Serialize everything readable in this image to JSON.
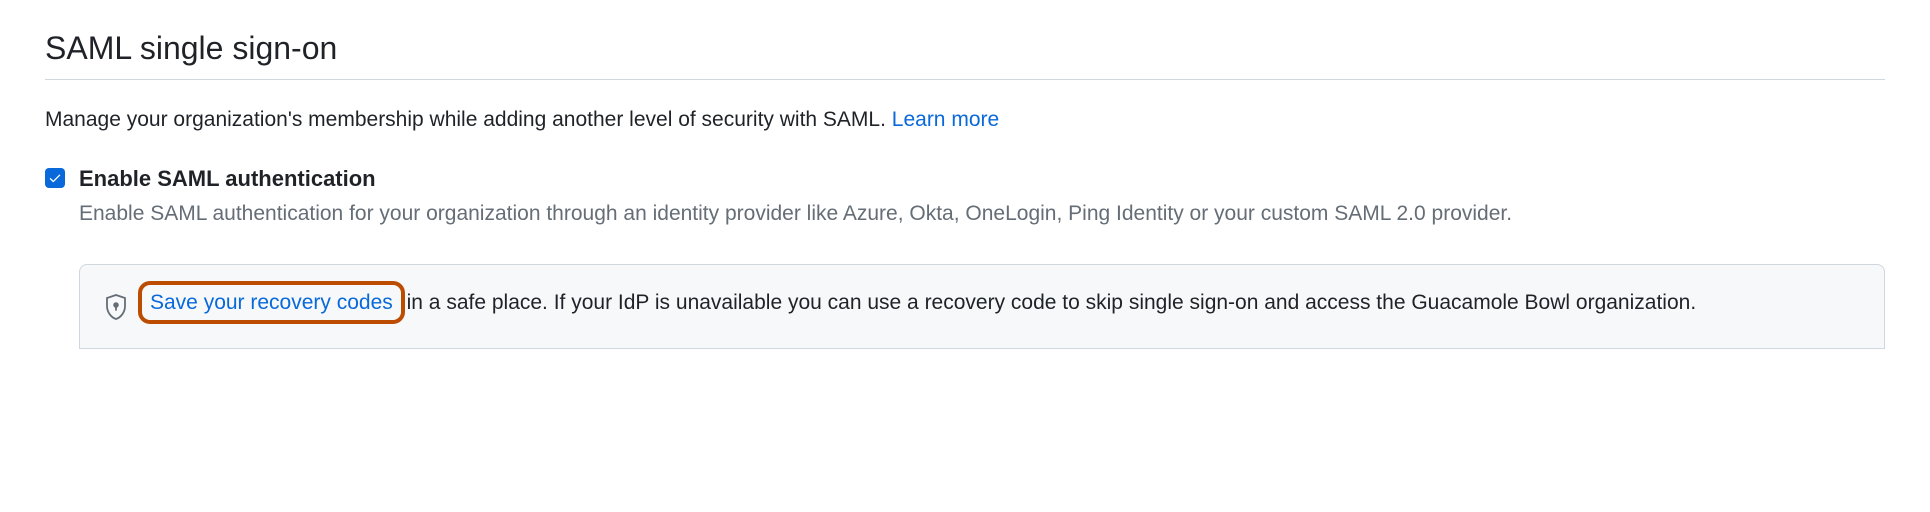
{
  "header": {
    "title": "SAML single sign-on"
  },
  "description": {
    "text": "Manage your organization's membership while adding another level of security with SAML. ",
    "link_text": "Learn more"
  },
  "enable_checkbox": {
    "label": "Enable SAML authentication",
    "sub": "Enable SAML authentication for your organization through an identity provider like Azure, Okta, OneLogin, Ping Identity or your custom SAML 2.0 provider."
  },
  "recovery_notice": {
    "link_text": "Save your recovery codes",
    "rest_text": " in a safe place. If your IdP is unavailable you can use a recovery code to skip single sign-on and access the Guacamole Bowl organization."
  }
}
